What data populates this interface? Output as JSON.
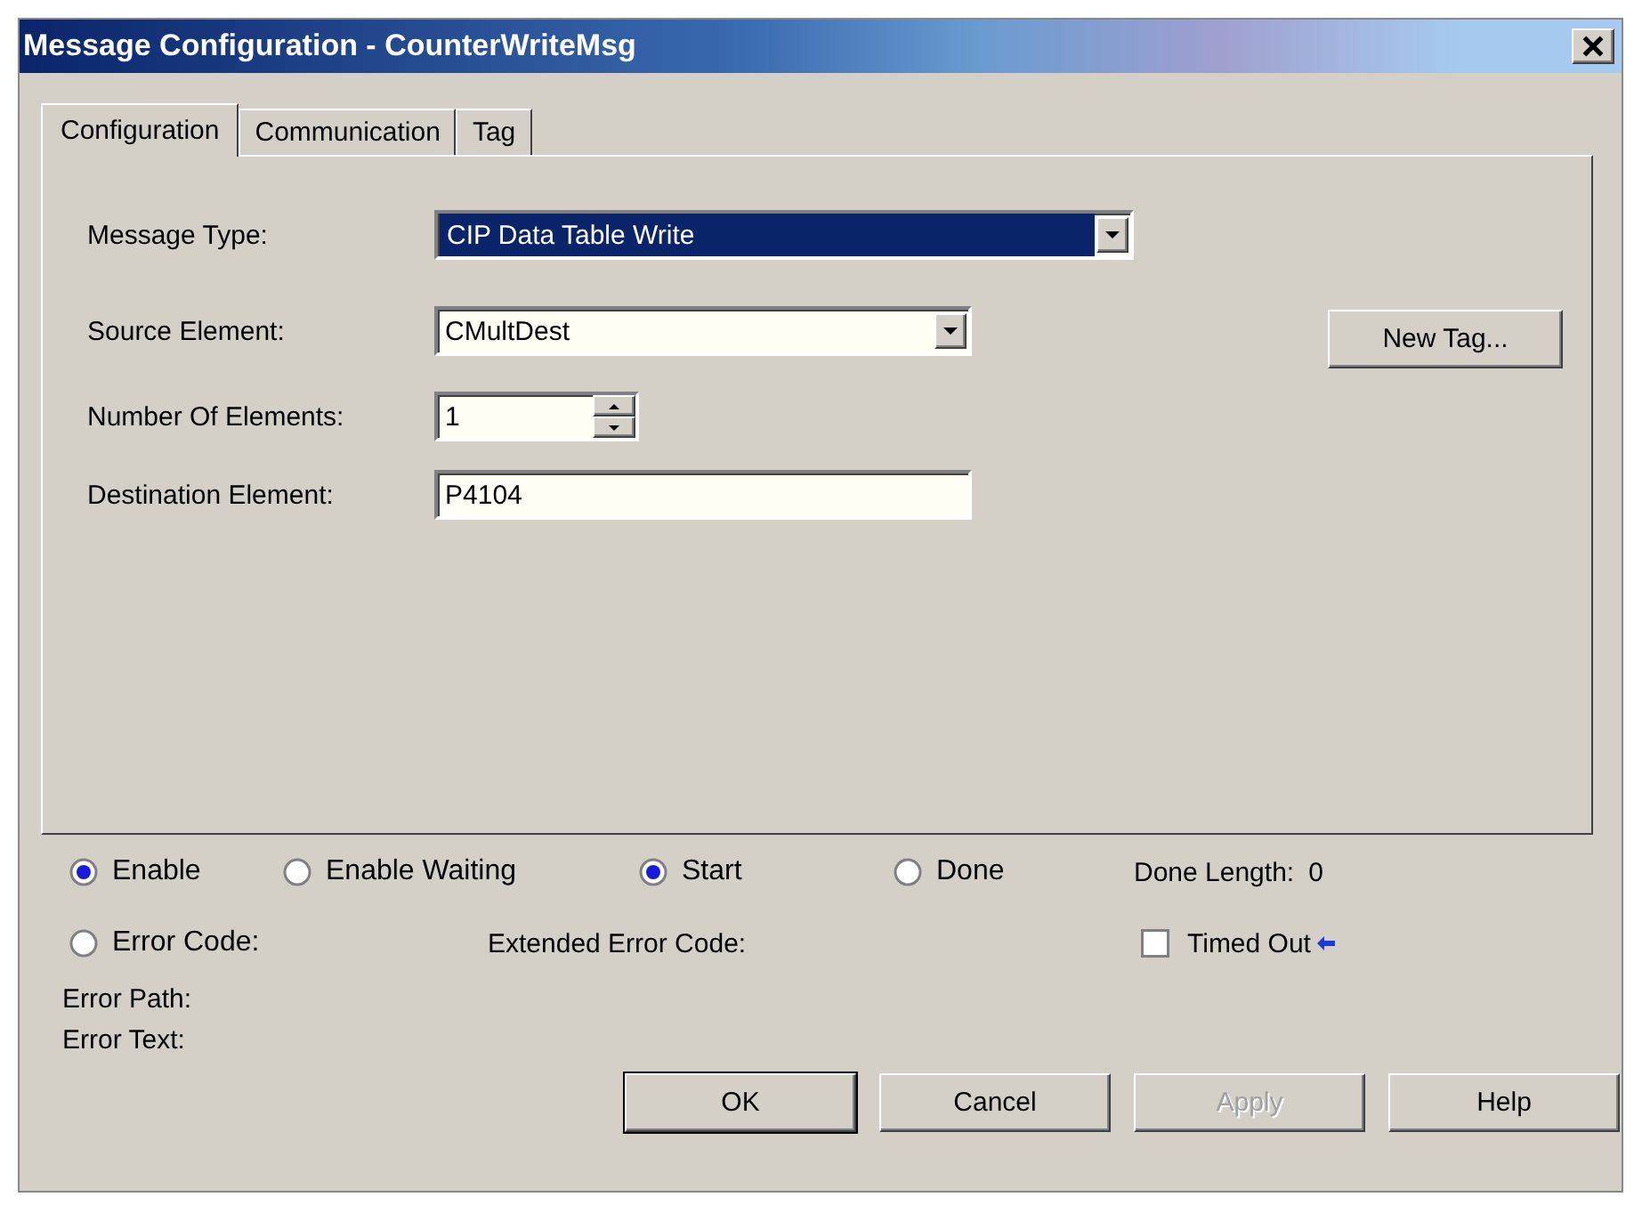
{
  "window": {
    "title": "Message Configuration - CounterWriteMsg"
  },
  "tabs": [
    {
      "label": "Configuration",
      "selected": true
    },
    {
      "label": "Communication",
      "selected": false
    },
    {
      "label": "Tag",
      "selected": false
    }
  ],
  "fields": [
    {
      "label": "Message Type:",
      "kind": "dropdown",
      "value": "CIP Data Table Write",
      "highlighted": true
    },
    {
      "label": "Source Element:",
      "kind": "dropdown",
      "value": "CMultDest",
      "highlighted": false
    },
    {
      "label": "Number Of Elements:",
      "kind": "spinner",
      "value": "1",
      "highlighted": false
    },
    {
      "label": "Destination Element:",
      "kind": "text",
      "value": "P4104",
      "highlighted": false
    }
  ],
  "new_tag_button": "New Tag...",
  "status": [
    {
      "label": "Enable",
      "on": true
    },
    {
      "label": "Enable Waiting",
      "on": false
    },
    {
      "label": "Start",
      "on": true
    },
    {
      "label": "Done",
      "on": false
    }
  ],
  "done_length": {
    "label": "Done Length:",
    "value": "0"
  },
  "error_code": {
    "label": "Error Code:",
    "on": false
  },
  "extended_error_code": "Extended Error Code:",
  "timed_out": {
    "label": "Timed Out",
    "checked": false
  },
  "error_path": "Error Path:",
  "error_text": "Error Text:",
  "buttons": [
    {
      "label": "OK",
      "disabled": false,
      "default": true
    },
    {
      "label": "Cancel",
      "disabled": false,
      "default": false
    },
    {
      "label": "Apply",
      "disabled": true,
      "default": false
    },
    {
      "label": "Help",
      "disabled": false,
      "default": false
    }
  ]
}
